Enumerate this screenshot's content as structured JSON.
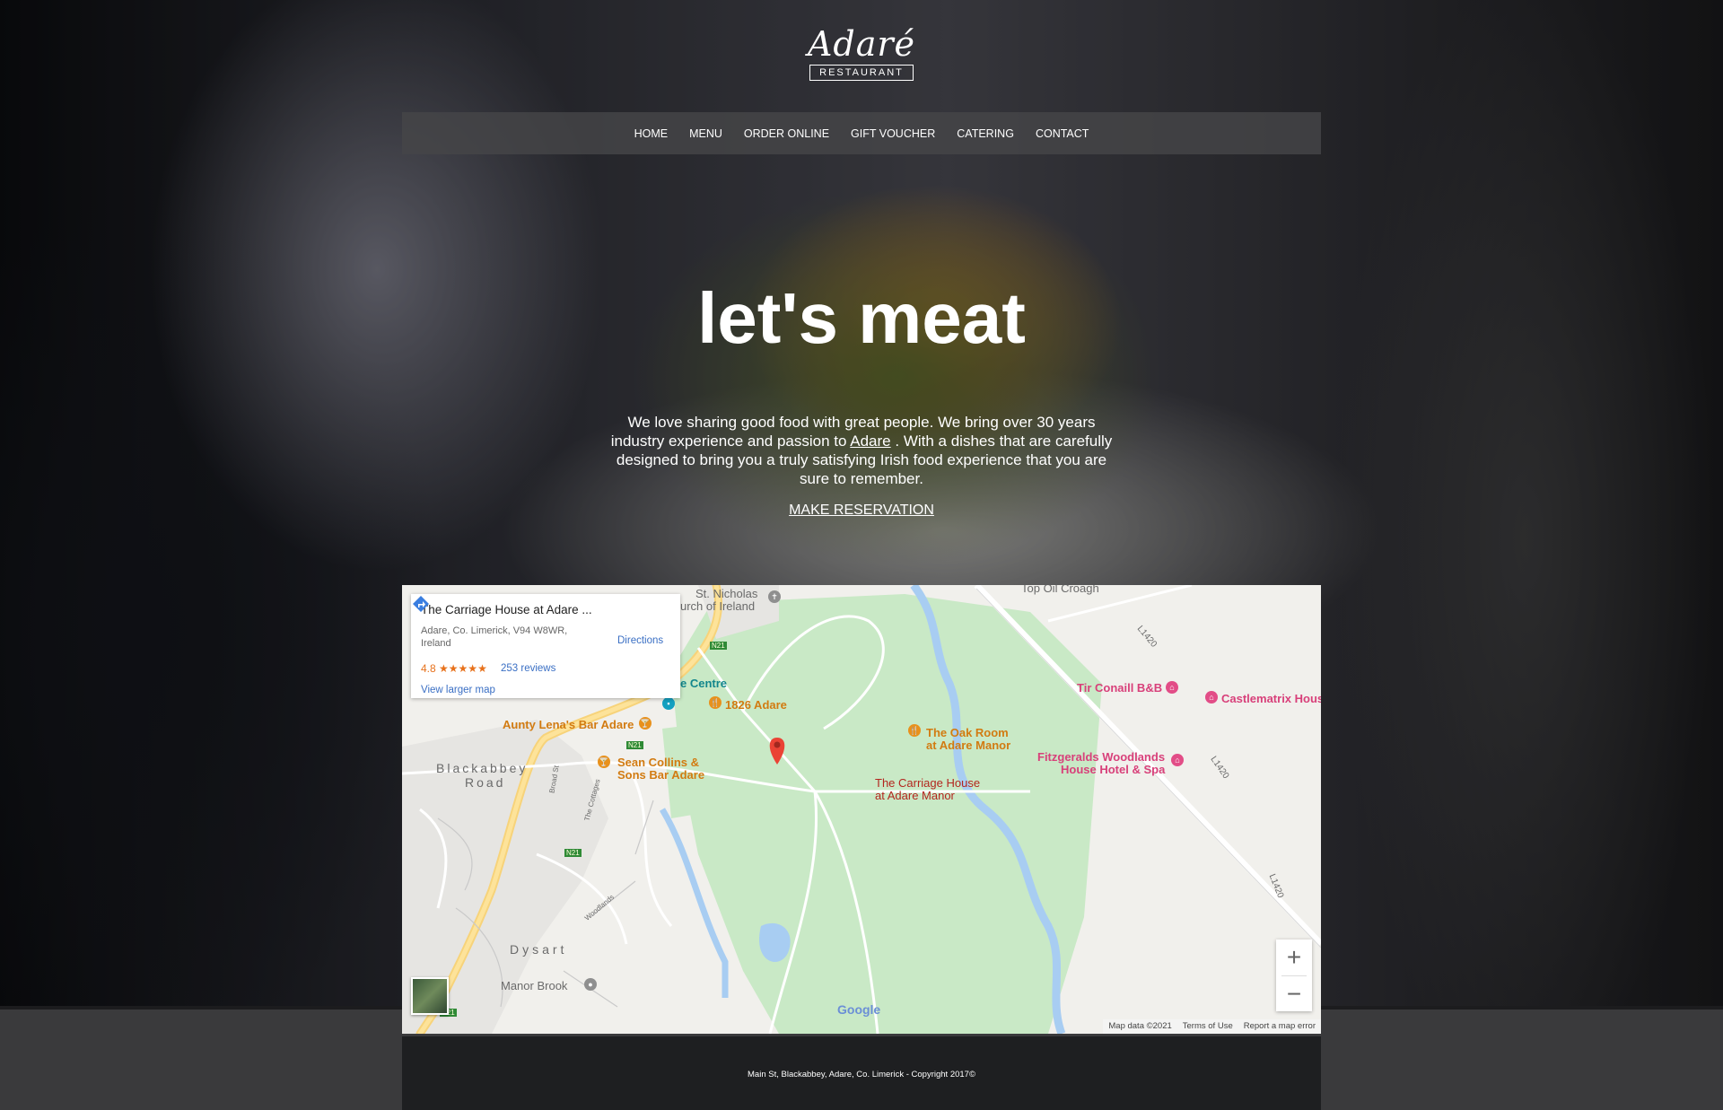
{
  "brand": {
    "name": "Adaré",
    "sub": "RESTAURANT"
  },
  "nav": {
    "items": [
      {
        "label": "HOME"
      },
      {
        "label": "MENU"
      },
      {
        "label": "ORDER ONLINE"
      },
      {
        "label": "GIFT VOUCHER"
      },
      {
        "label": "CATERING"
      },
      {
        "label": "CONTACT"
      }
    ]
  },
  "hero": {
    "headline": "let's meat",
    "intro_part1": "We love sharing good food with great people. We bring over 30 years industry experience and passion to",
    "intro_link": "Adare",
    "intro_part2": ". With a dishes that are carefully designed to bring you a truly satisfying Irish food experience that you are sure to remember.",
    "cta": "MAKE RESERVATION"
  },
  "map": {
    "card": {
      "title": "The Carriage House at Adare ...",
      "address": "Adare, Co. Limerick, V94 W8WR, Ireland",
      "rating": "4.8",
      "stars": "★★★★★",
      "reviews": "253 reviews",
      "directions": "Directions",
      "larger_map": "View larger map"
    },
    "labels": {
      "st_nicholas": "St. Nicholas",
      "church": "urch of Ireland",
      "top_oil": "Top Oil Croagh",
      "centre": "e Centre",
      "adare1826": "1826 Adare",
      "aunty": "Aunty Lena's Bar Adare",
      "oak_room_1": "The Oak Room",
      "oak_room_2": "at Adare Manor",
      "tir_conaill": "Tir Conaill B&B",
      "castlematrix": "Castlematrix Hous",
      "fitzgeralds_1": "Fitzgeralds Woodlands",
      "fitzgeralds_2": "House Hotel & Spa",
      "sean_1": "Sean Collins &",
      "sean_2": "Sons Bar Adare",
      "blackabbey_1": "Blackabbey",
      "blackabbey_2": "Road",
      "carriage_1": "The Carriage House",
      "carriage_2": "at Adare Manor",
      "dysart": "Dysart",
      "manor_brook": "Manor Brook",
      "road_n21": "N21",
      "road_l1420": "L1420",
      "broad_st": "Broad St",
      "the_cottages": "The Cottages",
      "woodlands": "Woodlands"
    },
    "zoom_in": "+",
    "zoom_out": "−",
    "google": "Google",
    "attribution": {
      "data": "Map data ©2021",
      "terms": "Terms of Use",
      "report": "Report a map error"
    }
  },
  "footer": {
    "text": "Main St, Blackabbey, Adare, Co. Limerick - Copyright 2017©"
  }
}
